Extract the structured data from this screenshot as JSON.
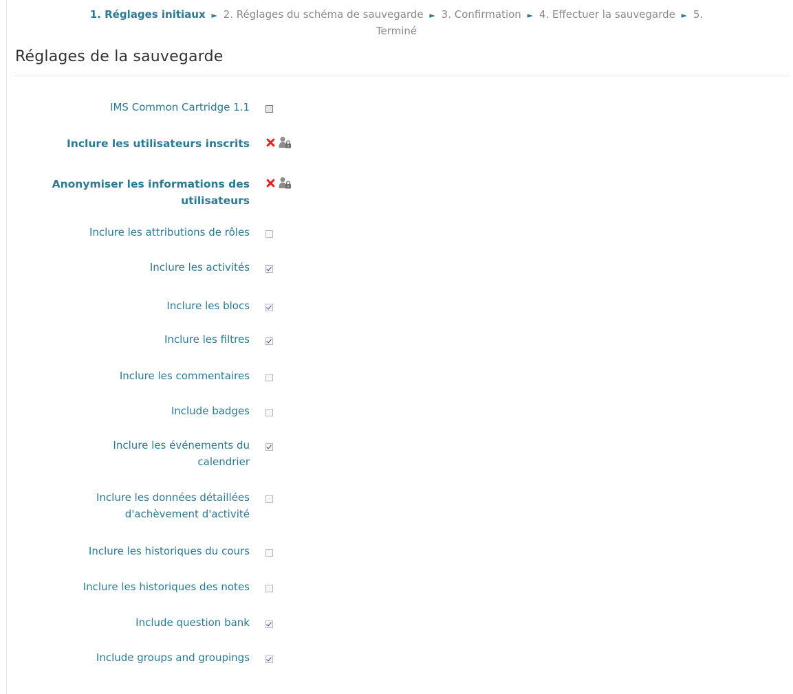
{
  "breadcrumb": {
    "step1": "1. Réglages initiaux",
    "step2": "2. Réglages du schéma de sauvegarde",
    "step3": "3. Confirmation",
    "step4": "4. Effectuer la sauvegarde",
    "step5_a": "5.",
    "step5_b": "Terminé",
    "separator": "►"
  },
  "section_title": "Réglages de la sauvegarde",
  "settings": [
    {
      "label": "IMS Common Cartridge 1.1",
      "checked": false,
      "style": "dark"
    },
    {
      "label": "Inclure les utilisateurs inscrits",
      "locked": true
    },
    {
      "label_line1": "Anonymiser les informations des",
      "label_line2": "utilisateurs",
      "locked": true
    },
    {
      "label": "Inclure les attributions de rôles",
      "checked": false
    },
    {
      "label": "Inclure les activités",
      "checked": true
    },
    {
      "label": "Inclure les blocs",
      "checked": true
    },
    {
      "label": "Inclure les filtres",
      "checked": true
    },
    {
      "label": "Inclure les commentaires",
      "checked": false
    },
    {
      "label": "Include badges",
      "checked": false
    },
    {
      "label_line1": "Inclure les événements du",
      "label_line2": "calendrier",
      "checked": true
    },
    {
      "label_line1": "Inclure les données détaillées",
      "label_line2": "d'achèvement d'activité",
      "checked": false
    },
    {
      "label": "Inclure les historiques du cours",
      "checked": false
    },
    {
      "label": "Inclure les historiques des notes",
      "checked": false
    },
    {
      "label": "Include question bank",
      "checked": true
    },
    {
      "label": "Include groups and groupings",
      "checked": true
    }
  ],
  "icons": {
    "not_allowed": "cross-icon",
    "locked_by_permissions": "user-lock-icon",
    "accent_color": "#2a7a94",
    "cross_color": "#e8211e"
  }
}
